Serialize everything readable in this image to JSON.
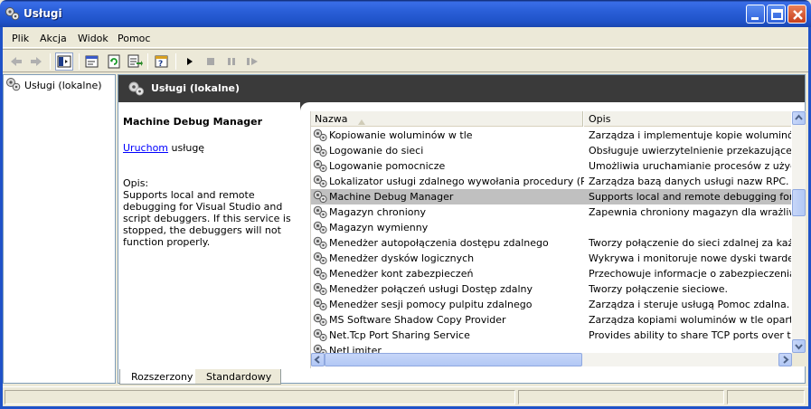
{
  "window": {
    "title": "Usługi"
  },
  "menu": [
    {
      "label": "Plik"
    },
    {
      "label": "Akcja"
    },
    {
      "label": "Widok"
    },
    {
      "label": "Pomoc"
    }
  ],
  "tree": {
    "root_label": "Usługi (lokalne)"
  },
  "panel": {
    "header_title": "Usługi (lokalne)"
  },
  "description": {
    "service_name": "Machine Debug Manager",
    "start_link": "Uruchom",
    "start_suffix": " usługę",
    "opis_label": "Opis:",
    "opis_text": "Supports local and remote debugging for Visual Studio and script debuggers. If this service is stopped, the debuggers will not function properly."
  },
  "list": {
    "columns": {
      "name": "Nazwa",
      "desc": "Opis"
    },
    "rows": [
      {
        "name": "Kopiowanie woluminów w tle",
        "desc": "Zarządza i implementuje kopie woluminów w tle"
      },
      {
        "name": "Logowanie do sieci",
        "desc": "Obsługuje uwierzytelnienie przekazujące zdarz"
      },
      {
        "name": "Logowanie pomocnicze",
        "desc": "Umożliwia uruchamianie procesów z użyciem alt"
      },
      {
        "name": "Lokalizator usługi zdalnego wywołania procedury (RPC)",
        "desc": "Zarządza bazą danych usługi nazw RPC."
      },
      {
        "name": "Machine Debug Manager",
        "desc": "Supports local and remote debugging for Visual"
      },
      {
        "name": "Magazyn chroniony",
        "desc": "Zapewnia chroniony magazyn dla wrażliwych d"
      },
      {
        "name": "Magazyn wymienny",
        "desc": ""
      },
      {
        "name": "Menedżer autopołączenia dostępu zdalnego",
        "desc": "Tworzy połączenie do sieci zdalnej za każdym r"
      },
      {
        "name": "Menedżer dysków logicznych",
        "desc": "Wykrywa i monitoruje nowe dyski twarde i wys"
      },
      {
        "name": "Menedżer kont zabezpieczeń",
        "desc": "Przechowuje informacje o zabezpieczeniach dla"
      },
      {
        "name": "Menedżer połączeń usługi Dostęp zdalny",
        "desc": "Tworzy połączenie sieciowe."
      },
      {
        "name": "Menedżer sesji pomocy pulpitu zdalnego",
        "desc": "Zarządza i steruje usługą Pomoc zdalna. Jeśli t"
      },
      {
        "name": "MS Software Shadow Copy Provider",
        "desc": "Zarządza kopiami woluminów w tle opartymi na"
      },
      {
        "name": "Net.Tcp Port Sharing Service",
        "desc": "Provides ability to share TCP ports over the ne"
      },
      {
        "name": "NetLimiter",
        "desc": ""
      }
    ],
    "selected_index": 4
  },
  "tabs": [
    {
      "label": "Rozszerzony"
    },
    {
      "label": "Standardowy"
    }
  ]
}
